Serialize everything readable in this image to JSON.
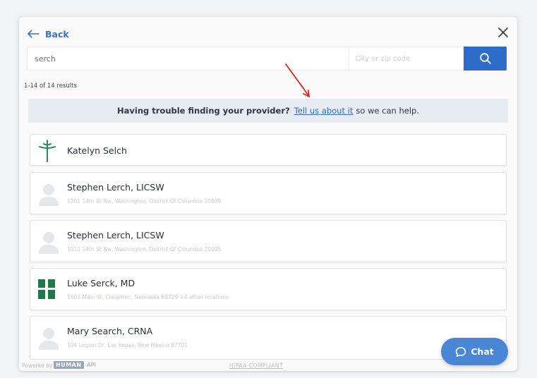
{
  "header": {
    "back_label": "Back"
  },
  "search": {
    "query_value": "serch",
    "location_placeholder": "City or zip code"
  },
  "results": {
    "count_text": "1-14 of 14 results"
  },
  "banner": {
    "question": "Having trouble finding your provider?",
    "link_text": "Tell us about it",
    "suffix": "so we can help."
  },
  "providers": [
    {
      "name": "Katelyn Selch",
      "address": "",
      "avatar": "cross-logo-icon"
    },
    {
      "name": "Stephen Lerch, LICSW",
      "address": "1701 14th St Nw, Washington, District Of Columbia 20009",
      "avatar": "person-placeholder-icon"
    },
    {
      "name": "Stephen Lerch, LICSW",
      "address": "1012 14th St Nw, Washington, District Of Columbia 20005",
      "avatar": "person-placeholder-icon"
    },
    {
      "name": "Luke Serck, MD",
      "address": "1503 Main St, Creighton, Nebraska 68729 +4 other locations",
      "avatar": "clinic-logo-icon"
    },
    {
      "name": "Mary Search, CRNA",
      "address": "104 Legion Dr, Las Vegas, New Mexico 87701",
      "avatar": "person-placeholder-icon"
    }
  ],
  "chat": {
    "label": "Chat"
  },
  "footer": {
    "powered_by": "Powered by",
    "brand": "HUMAN",
    "api": "API",
    "hipaa": "HIPAA COMPLIANT"
  },
  "colors": {
    "accent": "#2f6cc7",
    "annotation_arrow": "#e0241b",
    "cross_logo": "#2e8a5a",
    "clinic_logo": "#1f7a4a"
  }
}
